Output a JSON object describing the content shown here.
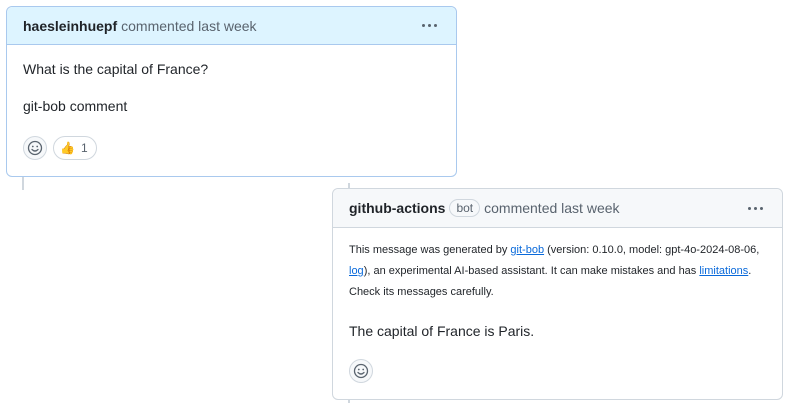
{
  "comment_user": {
    "author": "haesleinhuepf",
    "meta": "commented last week",
    "body": [
      "What is the capital of France?",
      "git-bob comment"
    ],
    "reaction": {
      "emoji": "👍",
      "count": "1"
    }
  },
  "comment_bot": {
    "author": "github-actions",
    "badge": "bot",
    "meta": "commented last week",
    "disclaimer": {
      "t1": "This message was generated by ",
      "link1": "git-bob",
      "t2": " (version: 0.10.0, model: gpt-4o-2024-08-06, ",
      "link2": "log",
      "t3": "), an experimental AI-based assistant. It can make mistakes and has ",
      "link3": "limitations",
      "t4": ". Check its messages carefully."
    },
    "answer": "The capital of France is Paris."
  },
  "colors": {
    "header_user_bg": "#ddf4ff",
    "header_bot_bg": "#f6f8fa",
    "link": "#0969da",
    "border": "#d0d7de"
  },
  "icons": [
    "kebab-menu-icon",
    "smiley-icon",
    "thumbs-up-icon"
  ]
}
